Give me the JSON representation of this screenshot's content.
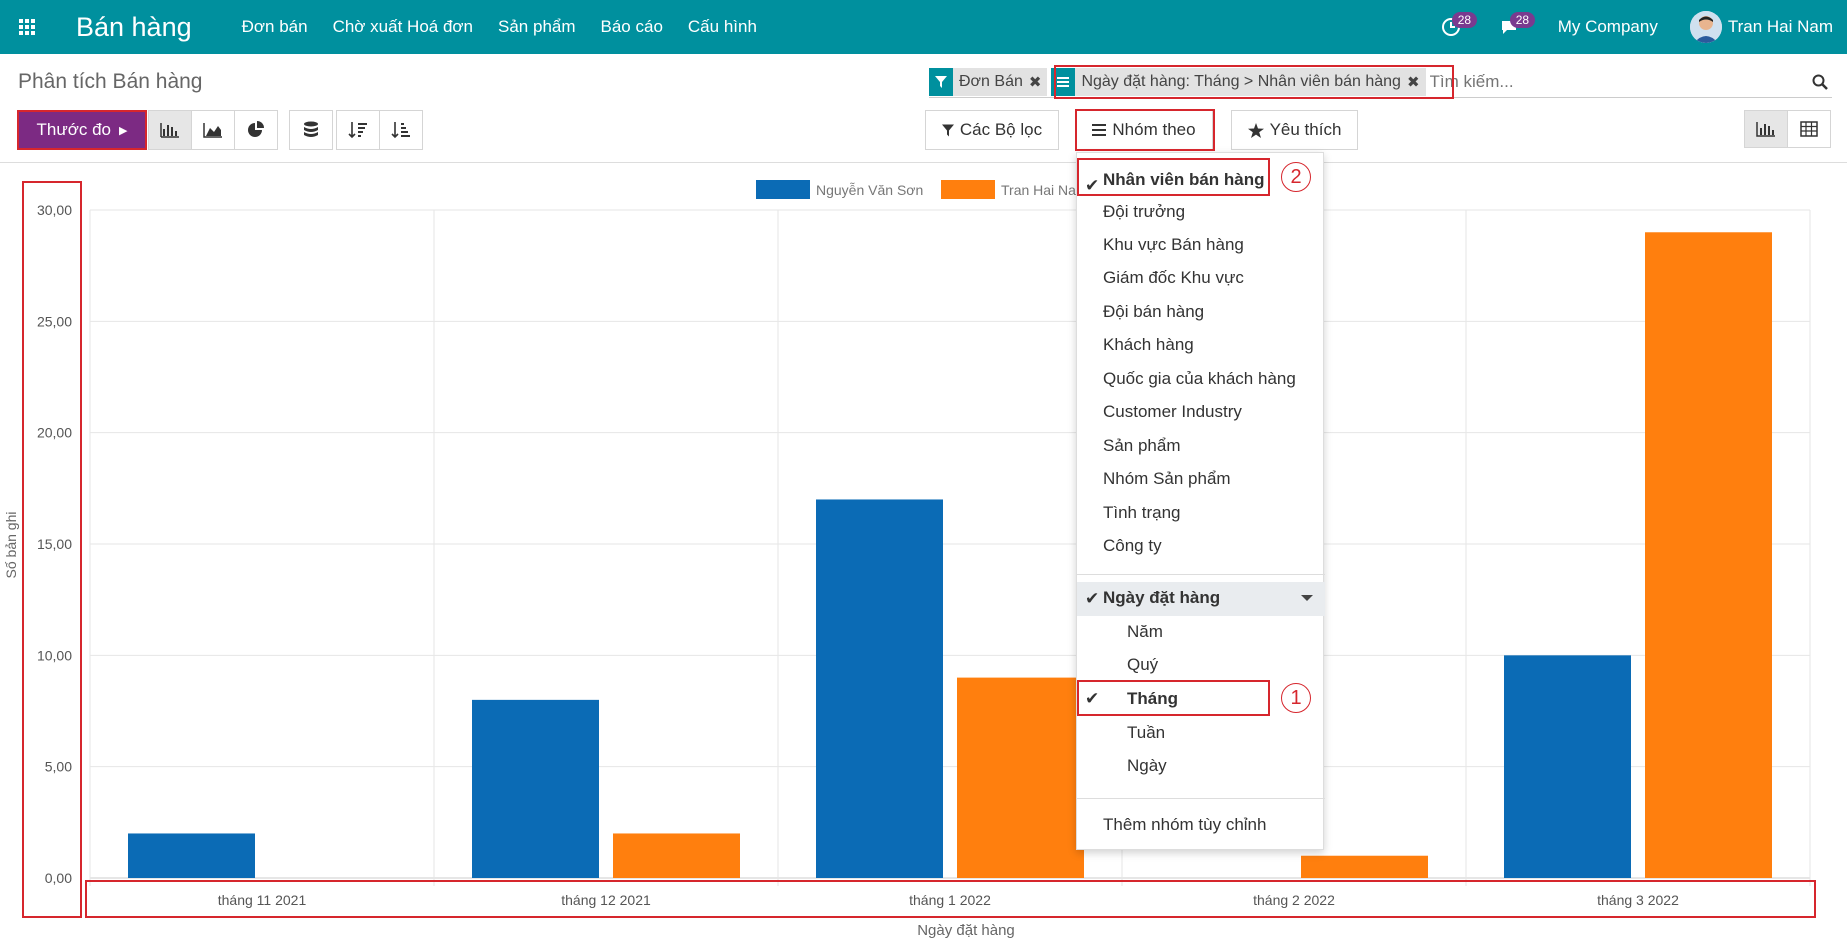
{
  "topbar": {
    "app_title": "Bán hàng",
    "menu": [
      "Đơn bán",
      "Chờ xuất Hoá đơn",
      "Sản phẩm",
      "Báo cáo",
      "Cấu hình"
    ],
    "activity_count": "28",
    "message_count": "28",
    "company": "My Company",
    "user": "Tran Hai Nam"
  },
  "page": {
    "title": "Phân tích Bán hàng"
  },
  "search": {
    "facets": [
      {
        "icon": "filter-icon",
        "label": "Đơn Bán"
      },
      {
        "icon": "groupby-icon",
        "label": "Ngày đặt hàng: Tháng > Nhân viên bán hàng"
      }
    ],
    "placeholder": "Tìm kiếm..."
  },
  "toolbar": {
    "measure_label": "Thước đo",
    "filters_label": "Các Bộ lọc",
    "groupby_label": "Nhóm theo",
    "favorites_label": "Yêu thích"
  },
  "groupby_menu": {
    "items": [
      {
        "label": "Nhân viên bán hàng",
        "checked": true
      },
      {
        "label": "Đội trưởng",
        "checked": false
      },
      {
        "label": "Khu vực Bán hàng",
        "checked": false
      },
      {
        "label": "Giám đốc Khu vực",
        "checked": false
      },
      {
        "label": "Đội bán hàng",
        "checked": false
      },
      {
        "label": "Khách hàng",
        "checked": false
      },
      {
        "label": "Quốc gia của khách hàng",
        "checked": false
      },
      {
        "label": "Customer Industry",
        "checked": false
      },
      {
        "label": "Sản phẩm",
        "checked": false
      },
      {
        "label": "Nhóm Sản phẩm",
        "checked": false
      },
      {
        "label": "Tình trạng",
        "checked": false
      },
      {
        "label": "Công ty",
        "checked": false
      }
    ],
    "date_group": {
      "label": "Ngày đặt hàng",
      "options": [
        {
          "label": "Năm",
          "checked": false
        },
        {
          "label": "Quý",
          "checked": false
        },
        {
          "label": "Tháng",
          "checked": true
        },
        {
          "label": "Tuần",
          "checked": false
        },
        {
          "label": "Ngày",
          "checked": false
        }
      ]
    },
    "custom_group_label": "Thêm nhóm tùy chỉnh"
  },
  "annotations": {
    "callout_1": "1",
    "callout_2": "2"
  },
  "colors": {
    "topbar": "#00909e",
    "primary": "#7c2a83",
    "series1": "#0b6bb5",
    "series2": "#ff7f0e",
    "highlight": "#d6262d"
  },
  "chart_data": {
    "type": "bar",
    "categories": [
      "tháng 11 2021",
      "tháng 12 2021",
      "tháng 1 2022",
      "tháng 2 2022",
      "tháng 3 2022"
    ],
    "series": [
      {
        "name": "Nguyễn Văn Sơn",
        "values": [
          2,
          8,
          17,
          0,
          10
        ]
      },
      {
        "name": "Tran Hai Nam",
        "values": [
          0,
          2,
          9,
          1,
          29
        ]
      }
    ],
    "xlabel": "Ngày đặt hàng",
    "ylabel": "Số bản ghi",
    "yticks": [
      "0,00",
      "5,00",
      "10,00",
      "15,00",
      "20,00",
      "25,00",
      "30,00"
    ],
    "ylim": [
      0,
      30
    ],
    "grid": true,
    "legend": "top"
  }
}
